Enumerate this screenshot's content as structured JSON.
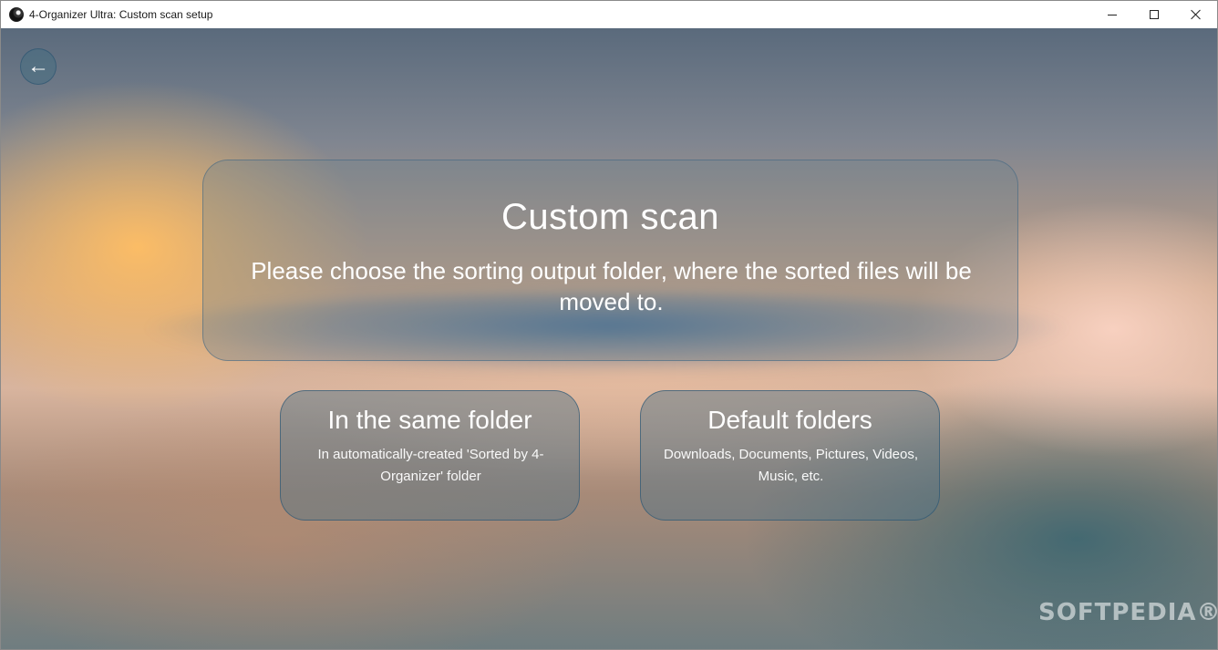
{
  "window": {
    "title": "4-Organizer Ultra: Custom scan setup"
  },
  "nav": {
    "back_glyph": "←"
  },
  "panel": {
    "title": "Custom scan",
    "description": "Please choose the sorting output folder, where the sorted files will be moved to."
  },
  "options": [
    {
      "title": "In the same folder",
      "description": "In automatically-created 'Sorted by 4-Organizer' folder"
    },
    {
      "title": "Default folders",
      "description": "Downloads, Documents, Pictures, Videos, Music, etc."
    }
  ],
  "watermark": "SOFTPEDIA®",
  "icons": {
    "app": "app-logo-icon",
    "back": "back-arrow-icon",
    "minimize": "minimize-icon",
    "maximize": "maximize-icon",
    "close": "close-icon"
  }
}
